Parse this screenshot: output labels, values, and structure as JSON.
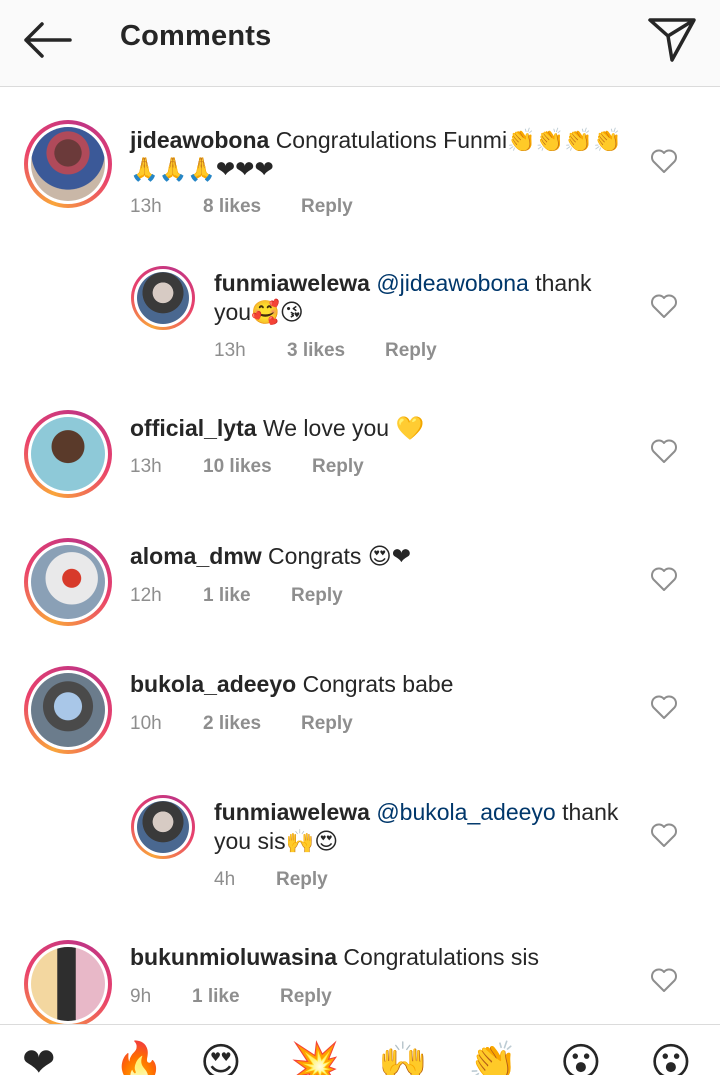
{
  "header": {
    "title": "Comments"
  },
  "comments": [
    {
      "username": "jideawobona",
      "text": "Congratulations Funmi👏👏👏👏🙏🙏🙏❤❤❤",
      "time": "13h",
      "likes": "8 likes",
      "reply": "Reply"
    },
    {
      "username": "funmiawelewa",
      "mention": "@jideawobona",
      "text": "thank you🥰😘",
      "time": "13h",
      "likes": "3 likes",
      "reply": "Reply"
    },
    {
      "username": "official_lyta",
      "text": "We love you 💛",
      "time": "13h",
      "likes": "10 likes",
      "reply": "Reply"
    },
    {
      "username": "aloma_dmw",
      "text": "Congrats 😍❤",
      "time": "12h",
      "likes": "1 like",
      "reply": "Reply"
    },
    {
      "username": "bukola_adeeyo",
      "text": "Congrats babe",
      "time": "10h",
      "likes": "2 likes",
      "reply": "Reply"
    },
    {
      "username": "funmiawelewa",
      "mention": "@bukola_adeeyo",
      "text": "thank you sis🙌😍",
      "time": "4h",
      "reply": "Reply"
    },
    {
      "username": "bukunmioluwasina",
      "text": "Congratulations sis",
      "time": "9h",
      "likes": "1 like",
      "reply": "Reply"
    }
  ],
  "reactions": [
    "❤",
    "🔥",
    "😍",
    "💥",
    "🙌",
    "👏",
    "😮",
    "😮"
  ],
  "colors": {
    "mention": "#00376b",
    "muted": "#8e8e8e",
    "text": "#262626",
    "ring_start": "#f9a53b",
    "ring_end": "#c13584"
  },
  "icons": {
    "back": "arrow-left-icon",
    "share": "paper-plane-icon",
    "like": "heart-outline-icon"
  }
}
